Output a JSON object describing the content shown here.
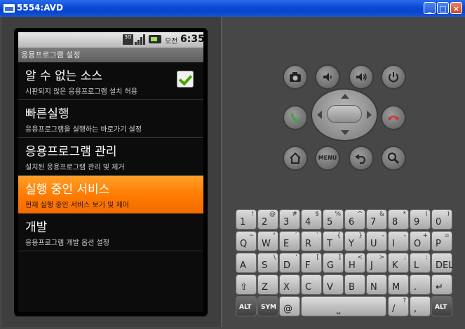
{
  "window": {
    "title": "5554:AVD",
    "minimize_label": "_",
    "maximize_label": "□",
    "close_label": "×"
  },
  "status_bar": {
    "network": "3G",
    "ampm": "오전",
    "time": "6:35"
  },
  "screen": {
    "header": "응용프로그램 설정",
    "items": [
      {
        "title": "알 수 없는 소스",
        "subtitle": "시판되지 않은 응용프로그램 설치 허용",
        "checked": true
      },
      {
        "title": "빠른실행",
        "subtitle": "응용프로그램을 실행하는 바로가기 설정"
      },
      {
        "title": "응용프로그램 관리",
        "subtitle": "설치된 응용프로그램 관리 및 제거"
      },
      {
        "title": "실행 중인 서비스",
        "subtitle": "현재 실행 중인 서비스 보기 및 제어",
        "selected": true
      },
      {
        "title": "개발",
        "subtitle": "응용프로그램 개발 옵션 설정"
      }
    ]
  },
  "hardware_buttons": {
    "row1": [
      "camera-icon",
      "volume-down-icon",
      "volume-up-icon",
      "power-icon"
    ],
    "row2": [
      "call-icon",
      "dpad",
      "end-call-icon"
    ],
    "row3": [
      "home-icon",
      "menu",
      "back-icon",
      "search-icon"
    ],
    "menu_label": "MENU",
    "colors": {
      "call": "#3aa63a",
      "end_call": "#d83030"
    }
  },
  "keyboard": {
    "rows": [
      [
        [
          "1",
          "!"
        ],
        [
          "2",
          "@"
        ],
        [
          "3",
          "#"
        ],
        [
          "4",
          "$"
        ],
        [
          "5",
          "%"
        ],
        [
          "6",
          "^"
        ],
        [
          "7",
          "&"
        ],
        [
          "8",
          "*"
        ],
        [
          "9",
          "("
        ],
        [
          "0",
          ")"
        ]
      ],
      [
        [
          "Q",
          "~"
        ],
        [
          "W",
          "\""
        ],
        [
          "E",
          "´"
        ],
        [
          "R",
          "`"
        ],
        [
          "T",
          "{"
        ],
        [
          "Y",
          "}"
        ],
        [
          "U",
          "-"
        ],
        [
          "I",
          "-"
        ],
        [
          "O",
          "+"
        ],
        [
          "P",
          "="
        ]
      ],
      [
        [
          "A",
          ""
        ],
        [
          "S",
          "\\"
        ],
        [
          "D",
          "'"
        ],
        [
          "F",
          "["
        ],
        [
          "G",
          "]"
        ],
        [
          "H",
          "<"
        ],
        [
          "J",
          ">"
        ],
        [
          "K",
          ";"
        ],
        [
          "L",
          ":"
        ],
        [
          "DEL",
          ""
        ]
      ],
      [
        [
          "⇧",
          ""
        ],
        [
          "Z",
          ""
        ],
        [
          "X",
          ""
        ],
        [
          "C",
          ""
        ],
        [
          "V",
          ""
        ],
        [
          "B",
          ""
        ],
        [
          "N",
          ""
        ],
        [
          "M",
          ""
        ],
        [
          ".",
          ""
        ],
        [
          "↵",
          ""
        ]
      ]
    ],
    "bottom": {
      "alt_left": "ALT",
      "sym": "SYM",
      "at": "@",
      "space": "⎵",
      "slash": "/",
      "question": "?",
      "comma": ",",
      "alt_right": "ALT"
    }
  }
}
